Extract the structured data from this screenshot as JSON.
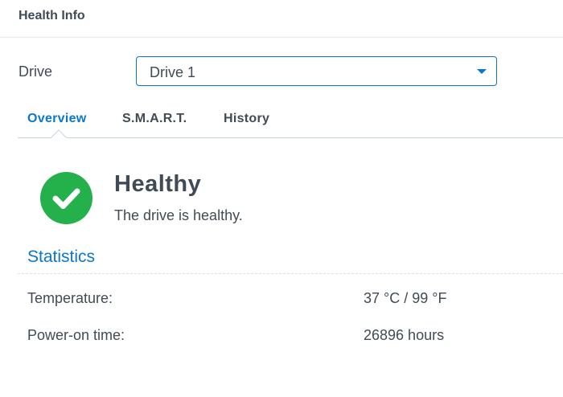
{
  "window": {
    "title": "Health Info"
  },
  "drive": {
    "label": "Drive",
    "selected": "Drive 1"
  },
  "tabs": [
    {
      "label": "Overview",
      "active": true
    },
    {
      "label": "S.M.A.R.T.",
      "active": false
    },
    {
      "label": "History",
      "active": false
    }
  ],
  "status": {
    "icon": "check-circle-icon",
    "color": "#24b14c",
    "title": "Healthy",
    "description": "The drive is healthy."
  },
  "statistics": {
    "title": "Statistics",
    "rows": [
      {
        "label": "Temperature:",
        "value": "37 °C / 99 °F"
      },
      {
        "label": "Power-on time:",
        "value": "26896 hours"
      }
    ]
  },
  "colors": {
    "accent": "#0a77cf",
    "healthy": "#24b14c",
    "text": "#414b55"
  }
}
